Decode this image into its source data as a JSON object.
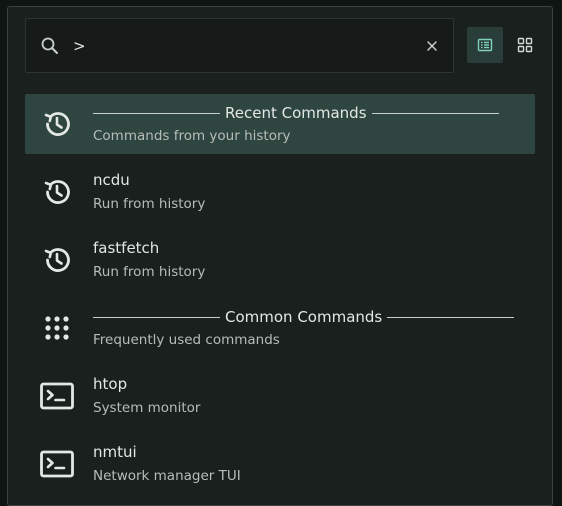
{
  "search": {
    "value": ">",
    "placeholder": ""
  },
  "icons": {
    "search": "search-icon",
    "clear": "close-icon",
    "list_view": "list-view-icon",
    "grid_view": "grid-view-icon",
    "history": "history-icon",
    "apps": "dots-grid-icon",
    "terminal": "terminal-icon"
  },
  "colors": {
    "background": "#1a201e",
    "selected_row": "#2f4540",
    "accent": "#7fd1bd",
    "text_primary": "#e3e8e5",
    "text_secondary": "#b6bdb9"
  },
  "results": [
    {
      "type": "header",
      "title": "Recent Commands",
      "subtitle": "Commands from your history",
      "icon": "history-icon",
      "selected": true
    },
    {
      "type": "command",
      "title": "ncdu",
      "subtitle": "Run from history",
      "icon": "history-icon"
    },
    {
      "type": "command",
      "title": "fastfetch",
      "subtitle": "Run from history",
      "icon": "history-icon"
    },
    {
      "type": "header",
      "title": "Common Commands",
      "subtitle": "Frequently used commands",
      "icon": "dots-grid-icon"
    },
    {
      "type": "command",
      "title": "htop",
      "subtitle": "System monitor",
      "icon": "terminal-icon"
    },
    {
      "type": "command",
      "title": "nmtui",
      "subtitle": "Network manager TUI",
      "icon": "terminal-icon"
    }
  ]
}
